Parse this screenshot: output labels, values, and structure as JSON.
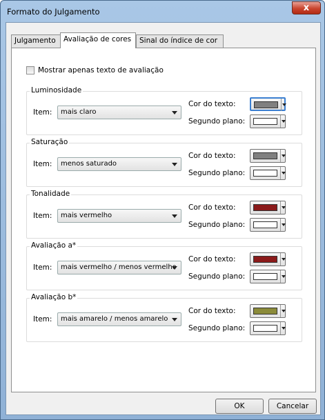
{
  "window": {
    "title": "Formato do Julgamento",
    "close_glyph": "x"
  },
  "tabs": [
    {
      "label": "Julgamento"
    },
    {
      "label": "Avaliação de cores"
    },
    {
      "label": "Sinal do índice de cor"
    }
  ],
  "checkbox": {
    "label": "Mostrar apenas texto de avaliação",
    "checked": false
  },
  "labels": {
    "item": "Item:",
    "text_color": "Cor do texto:",
    "background": "Segundo plano:"
  },
  "groups": [
    {
      "title": "Luminosidade",
      "selected": "mais claro",
      "text_color": "#808080",
      "bg_color": "#ffffff"
    },
    {
      "title": "Saturação",
      "selected": "menos saturado",
      "text_color": "#808080",
      "bg_color": "#ffffff"
    },
    {
      "title": "Tonalidade",
      "selected": "mais vermelho",
      "text_color": "#8b1a1a",
      "bg_color": "#ffffff"
    },
    {
      "title": "Avaliação a*",
      "selected": "mais vermelho / menos vermelho",
      "text_color": "#8b1a1a",
      "bg_color": "#ffffff"
    },
    {
      "title": "Avaliação b*",
      "selected": "mais amarelo / menos amarelo",
      "text_color": "#8b8b3a",
      "bg_color": "#ffffff"
    }
  ],
  "buttons": {
    "ok": "OK",
    "cancel": "Cancelar"
  }
}
